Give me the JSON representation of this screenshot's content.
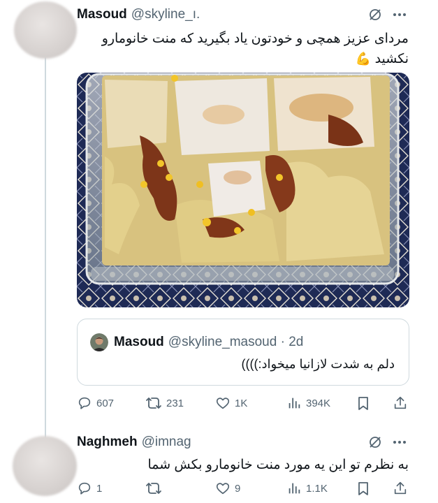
{
  "tweet": {
    "author_name": "Masoud",
    "author_handle": "@skyline_ı.",
    "text": "مردای عزیز همچی و خودتون یاد بگیرید که منت خانومارو نکشید",
    "text_emoji": "💪",
    "media_alt": "lasagna-photo",
    "quoted": {
      "author_name": "Masoud",
      "author_handle": "@skyline_masoud · 2d",
      "text": "دلم به شدت لازانیا میخواد:))))"
    },
    "stats": {
      "replies": "607",
      "retweets": "231",
      "likes": "1K",
      "views": "394K"
    }
  },
  "reply": {
    "author_name": "Naghmeh",
    "author_handle": "@imnag",
    "text": "به نظرم تو این یه مورد منت خانومارو بکش شما",
    "stats": {
      "replies": "1",
      "retweets": "",
      "likes": "9",
      "views": "1.1K"
    }
  },
  "colors": {
    "text": "#0f1419",
    "secondary": "#536471",
    "border": "#cfd9de",
    "bg": "#ffffff"
  },
  "icons": [
    "grok-slash-icon",
    "more-dots-icon",
    "reply-icon",
    "retweet-icon",
    "like-icon",
    "views-icon",
    "bookmark-icon",
    "share-icon"
  ]
}
